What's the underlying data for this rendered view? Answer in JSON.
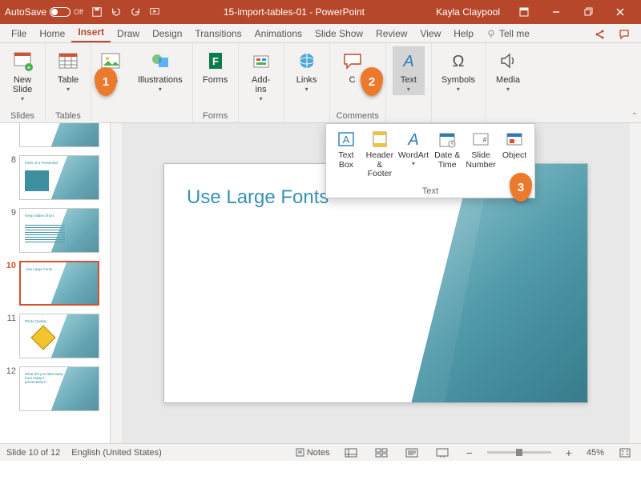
{
  "titlebar": {
    "autosave_label": "AutoSave",
    "autosave_state": "Off",
    "doc_title": "15-import-tables-01 - PowerPoint",
    "user": "Kayla Claypool"
  },
  "tabs": {
    "file": "File",
    "home": "Home",
    "insert": "Insert",
    "draw": "Draw",
    "design": "Design",
    "transitions": "Transitions",
    "animations": "Animations",
    "slideshow": "Slide Show",
    "review": "Review",
    "view": "View",
    "help": "Help",
    "tellme": "Tell me"
  },
  "ribbon": {
    "slides": {
      "new_slide": "New\nSlide",
      "label": "Slides"
    },
    "tables": {
      "table": "Table",
      "label": "Tables"
    },
    "images": {
      "btn": "ges",
      "full": "Images"
    },
    "illustrations": {
      "btn": "Illustrations"
    },
    "forms": {
      "btn": "Forms",
      "label": "Forms"
    },
    "addins": {
      "btn": "Add-\nins"
    },
    "links": {
      "btn": "Links"
    },
    "comments": {
      "btn": "C",
      "label": "Comments"
    },
    "text": {
      "btn": "Text"
    },
    "symbols": {
      "btn": "Symbols"
    },
    "media": {
      "btn": "Media"
    }
  },
  "flyout": {
    "textbox": "Text\nBox",
    "header_footer": "Header\n& Footer",
    "wordart": "WordArt",
    "date_time": "Date &\nTime",
    "slide_number": "Slide\nNumber",
    "object": "Object",
    "label": "Text"
  },
  "slide": {
    "title": "Use Large Fonts"
  },
  "thumbs": {
    "n8": "8",
    "n9": "9",
    "n10": "10",
    "n11": "11",
    "n12": "12",
    "t10": "Use Large Fonts",
    "t11": "Photo Quality",
    "t12": "What did you take away from today's presentation?"
  },
  "status": {
    "slide_counter": "Slide 10 of 12",
    "language": "English (United States)",
    "notes": "Notes",
    "zoom": "45%"
  },
  "badges": {
    "b1": "1",
    "b2": "2",
    "b3": "3"
  }
}
